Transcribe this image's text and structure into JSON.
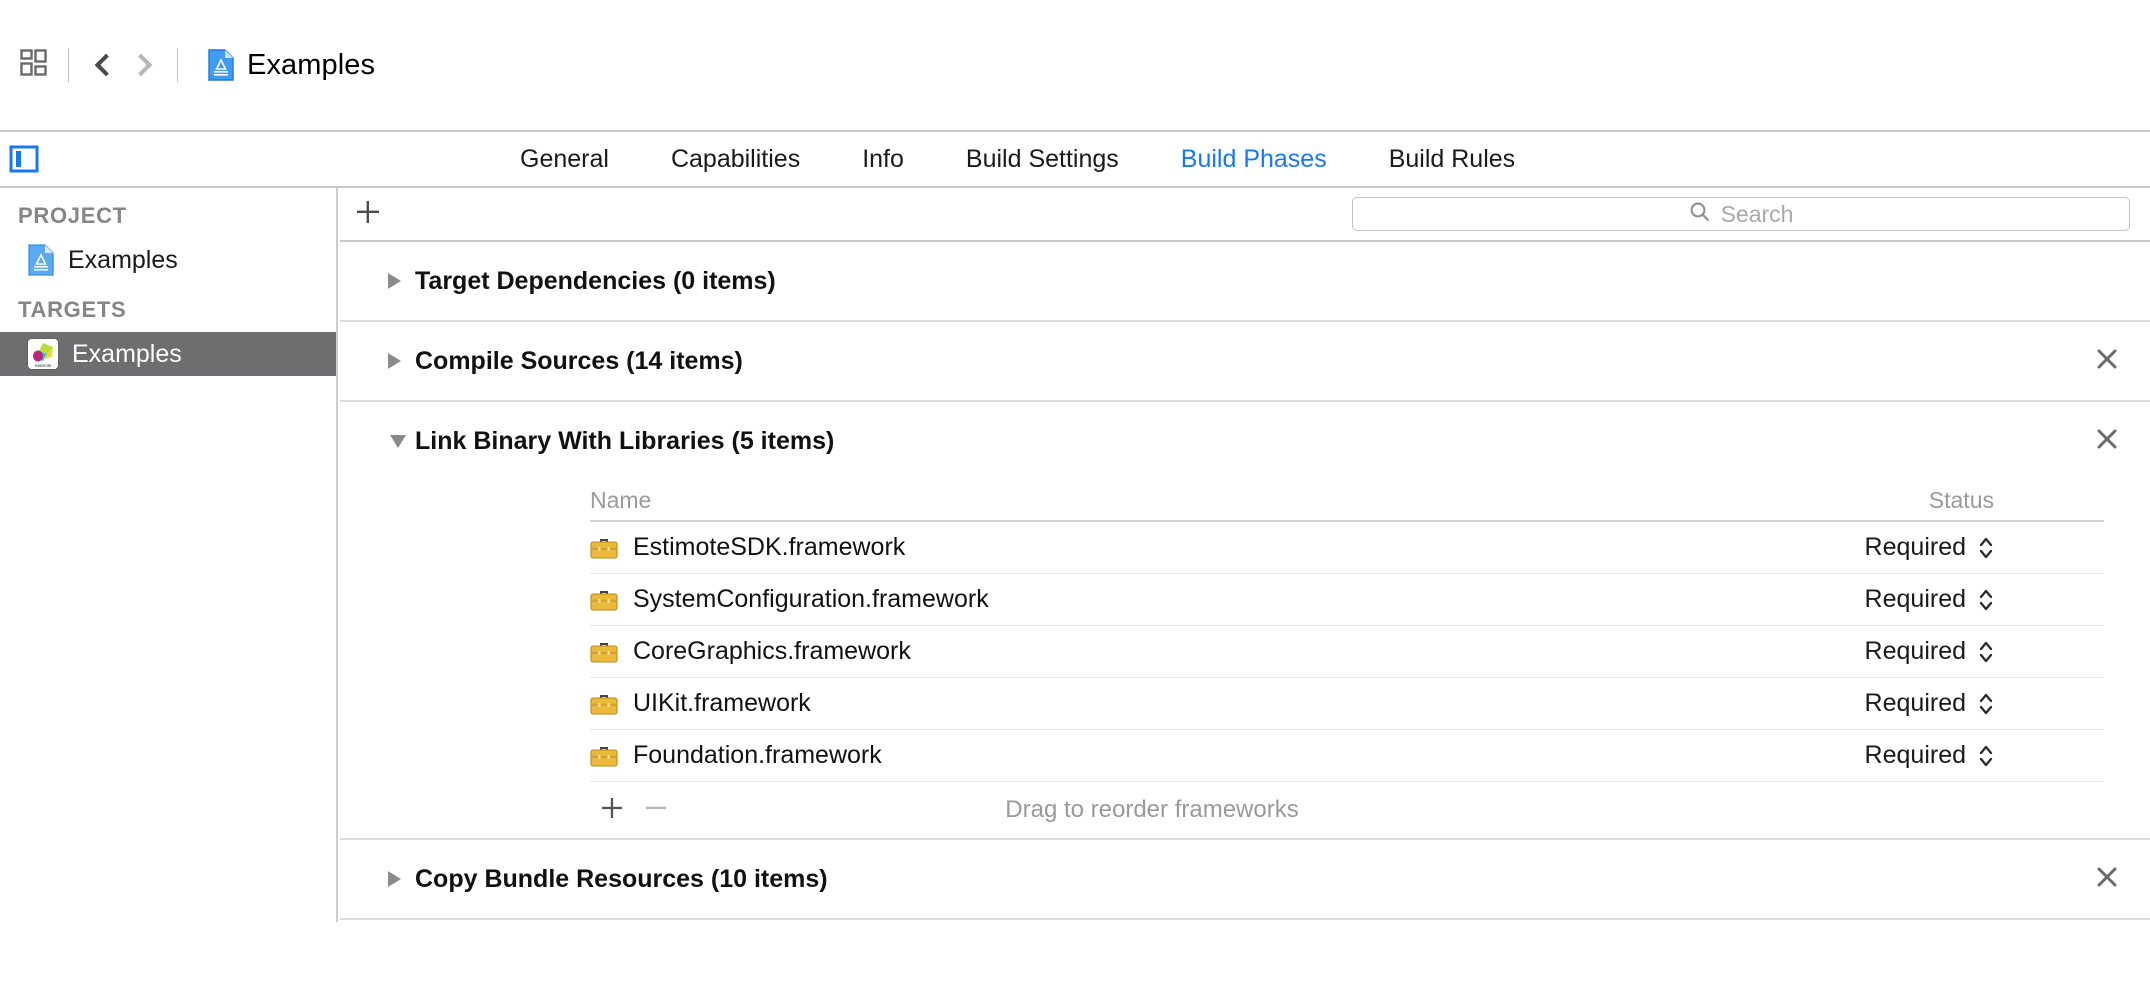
{
  "toolbar": {
    "scheme_icon": "grid-squares-icon",
    "back_icon": "chevron-left-icon",
    "forward_icon": "chevron-right-icon",
    "breadcrumb_icon": "xcode-project-document-icon",
    "breadcrumb_label": "Examples"
  },
  "editor_toggle": {
    "name": "navigator-toggle-icon",
    "active_color": "#1878f0"
  },
  "tabs": [
    {
      "label": "General",
      "active": false
    },
    {
      "label": "Capabilities",
      "active": false
    },
    {
      "label": "Info",
      "active": false
    },
    {
      "label": "Build Settings",
      "active": false
    },
    {
      "label": "Build Phases",
      "active": true
    },
    {
      "label": "Build Rules",
      "active": false
    }
  ],
  "sidebar": {
    "project_group_label": "PROJECT",
    "project_item": {
      "label": "Examples",
      "icon": "xcode-project-document-icon"
    },
    "targets_group_label": "TARGETS",
    "target_item": {
      "label": "Examples",
      "icon": "estimote-app-icon",
      "selected": true
    }
  },
  "content_header": {
    "add_phase_label": "+",
    "search": {
      "placeholder": "Search",
      "value": "",
      "icon": "search-icon"
    }
  },
  "phases": [
    {
      "title": "Target Dependencies (0 items)",
      "expanded": false,
      "removable": false
    },
    {
      "title": "Compile Sources (14 items)",
      "expanded": false,
      "removable": true
    },
    {
      "title": "Link Binary With Libraries (5 items)",
      "expanded": true,
      "removable": true
    },
    {
      "title": "Copy Bundle Resources (10 items)",
      "expanded": false,
      "removable": true
    }
  ],
  "frameworks_table": {
    "columns": {
      "name": "Name",
      "status": "Status"
    },
    "rows": [
      {
        "name": "EstimoteSDK.framework",
        "status": "Required",
        "icon": "framework-briefcase-icon"
      },
      {
        "name": "SystemConfiguration.framework",
        "status": "Required",
        "icon": "framework-briefcase-icon"
      },
      {
        "name": "CoreGraphics.framework",
        "status": "Required",
        "icon": "framework-briefcase-icon"
      },
      {
        "name": "UIKit.framework",
        "status": "Required",
        "icon": "framework-briefcase-icon"
      },
      {
        "name": "Foundation.framework",
        "status": "Required",
        "icon": "framework-briefcase-icon"
      }
    ],
    "footer": {
      "add_label": "+",
      "remove_label": "−",
      "hint": "Drag to reorder frameworks"
    }
  },
  "colors": {
    "accent_blue": "#1878f0",
    "selection_gray": "#6e6e70",
    "muted_text": "#9a9a9a",
    "framework_gold": "#e8b634"
  }
}
